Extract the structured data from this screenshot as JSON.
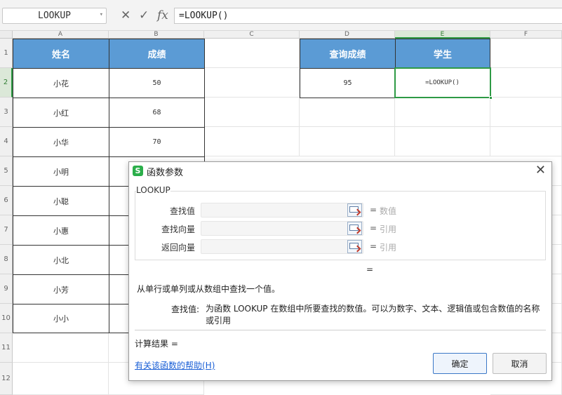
{
  "formula_bar": {
    "name_box": "LOOKUP",
    "cancel_icon": "✕",
    "confirm_icon": "✓",
    "fx_icon": "fx",
    "formula": "=LOOKUP()"
  },
  "columns": [
    "A",
    "B",
    "C",
    "D",
    "E",
    "F"
  ],
  "rows": [
    "1",
    "2",
    "3",
    "4",
    "5",
    "6",
    "7",
    "8",
    "9",
    "10",
    "11",
    "12"
  ],
  "sheet": {
    "header_name": "姓名",
    "header_score": "成绩",
    "header_query": "查询成绩",
    "header_student": "学生",
    "query_value": "95",
    "active_cell_text": "=LOOKUP()",
    "names": [
      "小花",
      "小红",
      "小华",
      "小明",
      "小聪",
      "小惠",
      "小北",
      "小芳",
      "小小"
    ],
    "scores": [
      "50",
      "68",
      "70"
    ]
  },
  "dialog": {
    "title": "函数参数",
    "close_icon": "✕",
    "function_name": "LOOKUP",
    "args": [
      {
        "label": "查找值",
        "hint": "数值"
      },
      {
        "label": "查找向量",
        "hint": "引用"
      },
      {
        "label": "返回向量",
        "hint": "引用"
      }
    ],
    "equals": "=",
    "result_equals": "=",
    "description": "从单行或单列或从数组中查找一个值。",
    "param_name": "查找值:",
    "param_desc": "为函数 LOOKUP 在数组中所要查找的数值。可以为数字、文本、逻辑值或包含数值的名称或引用",
    "calc_result": "计算结果 =",
    "help_link": "有关该函数的帮助(H)",
    "ok_label": "确定",
    "cancel_label": "取消"
  },
  "colors": {
    "header_fill": "#5b9bd5",
    "selection": "#2e9a45",
    "dialog_logo": "#2bae4a"
  }
}
